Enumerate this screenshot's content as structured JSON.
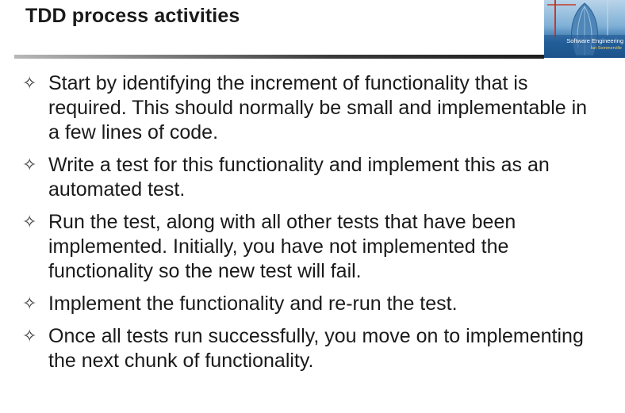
{
  "slide": {
    "title": "TDD process activities"
  },
  "book_cover": {
    "title": "Software Engineering",
    "author": "Ian Sommerville",
    "icon": "book-cover-image"
  },
  "bullet_symbol": "✧",
  "bullets": [
    {
      "text": "Start by identifying the increment of functionality that is required. This should normally be small and implementable in a few lines of code."
    },
    {
      "text": "Write a test for this functionality and implement this as an automated test."
    },
    {
      "text": "Run the test, along with all other tests that have been implemented. Initially, you have not implemented the functionality so the new test will fail."
    },
    {
      "text": "Implement the functionality and re-run the test."
    },
    {
      "text": "Once all tests run successfully, you move on to implementing the next chunk of functionality."
    }
  ]
}
